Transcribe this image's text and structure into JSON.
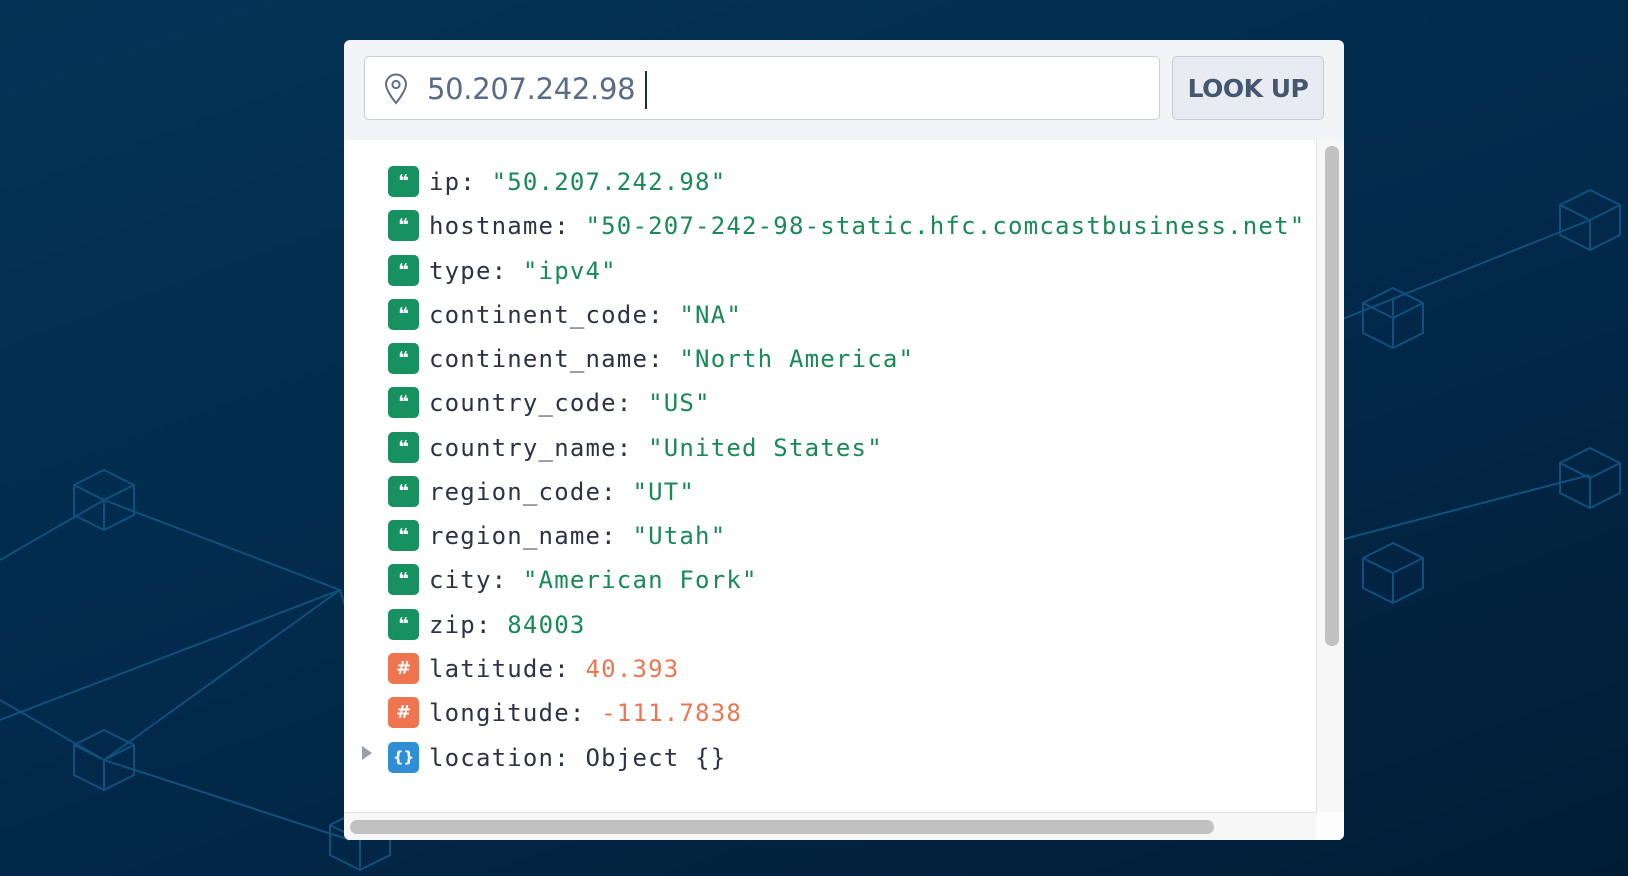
{
  "search": {
    "value": "50.207.242.98",
    "button_label": "LOOK UP",
    "pin_icon": "map-pin-icon"
  },
  "badge_glyphs": {
    "string": "❝",
    "number": "#",
    "object": "{}"
  },
  "results": [
    {
      "key": "ip:",
      "value": "\"50.207.242.98\"",
      "type": "string"
    },
    {
      "key": "hostname:",
      "value": "\"50-207-242-98-static.hfc.comcastbusiness.net\"",
      "type": "string"
    },
    {
      "key": "type:",
      "value": "\"ipv4\"",
      "type": "string"
    },
    {
      "key": "continent_code:",
      "value": "\"NA\"",
      "type": "string"
    },
    {
      "key": "continent_name:",
      "value": "\"North America\"",
      "type": "string"
    },
    {
      "key": "country_code:",
      "value": "\"US\"",
      "type": "string"
    },
    {
      "key": "country_name:",
      "value": "\"United States\"",
      "type": "string"
    },
    {
      "key": "region_code:",
      "value": "\"UT\"",
      "type": "string"
    },
    {
      "key": "region_name:",
      "value": "\"Utah\"",
      "type": "string"
    },
    {
      "key": "city:",
      "value": "\"American Fork\"",
      "type": "string"
    },
    {
      "key": "zip:",
      "value": "84003",
      "type": "string"
    },
    {
      "key": "latitude:",
      "value": "40.393",
      "type": "number"
    },
    {
      "key": "longitude:",
      "value": "-111.7838",
      "type": "number"
    },
    {
      "key": "location:",
      "value": "Object {}",
      "type": "object"
    }
  ],
  "colors": {
    "string_badge": "#179160",
    "number_badge": "#ee7550",
    "object_badge": "#2f8fd6",
    "string_value": "#178a56",
    "number_value": "#ee7550"
  }
}
